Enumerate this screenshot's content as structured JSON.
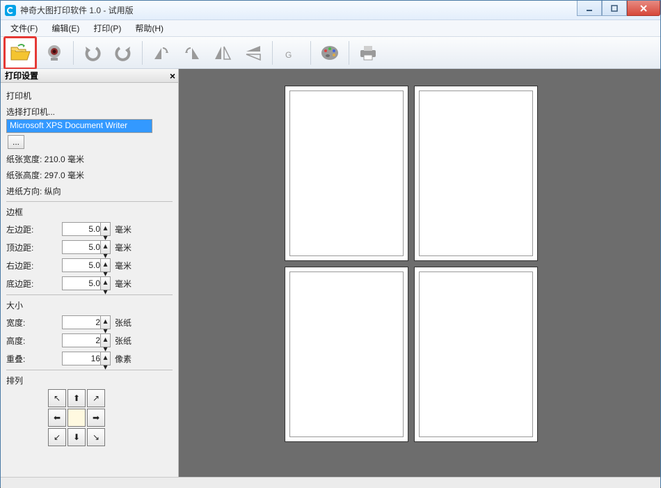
{
  "window": {
    "title": "神奇大图打印软件 1.0 - 试用版"
  },
  "menu": {
    "file": "文件(F)",
    "edit": "编辑(E)",
    "print": "打印(P)",
    "help": "帮助(H)"
  },
  "sidepanel": {
    "title": "打印设置",
    "printer_label": "打印机",
    "select_printer_label": "选择打印机...",
    "selected_printer": "Microsoft XPS Document Writer",
    "more": "...",
    "paper_width_line": "纸张宽度:  210.0 毫米",
    "paper_height_line": "纸张高度:  297.0 毫米",
    "feed_dir_line": "进纸方向:  纵向",
    "border_label": "边框",
    "margins": {
      "left_label": "左边距:",
      "top_label": "顶边距:",
      "right_label": "右边距:",
      "bottom_label": "底边距:",
      "left": "5.0",
      "top": "5.0",
      "right": "5.0",
      "bottom": "5.0",
      "unit": "毫米"
    },
    "size_label": "大小",
    "size": {
      "width_label": "宽度:",
      "height_label": "高度:",
      "overlap_label": "重叠:",
      "width": "2",
      "height": "2",
      "overlap": "16",
      "sheet_unit": "张纸",
      "px_unit": "像素"
    },
    "arrange_label": "排列"
  }
}
